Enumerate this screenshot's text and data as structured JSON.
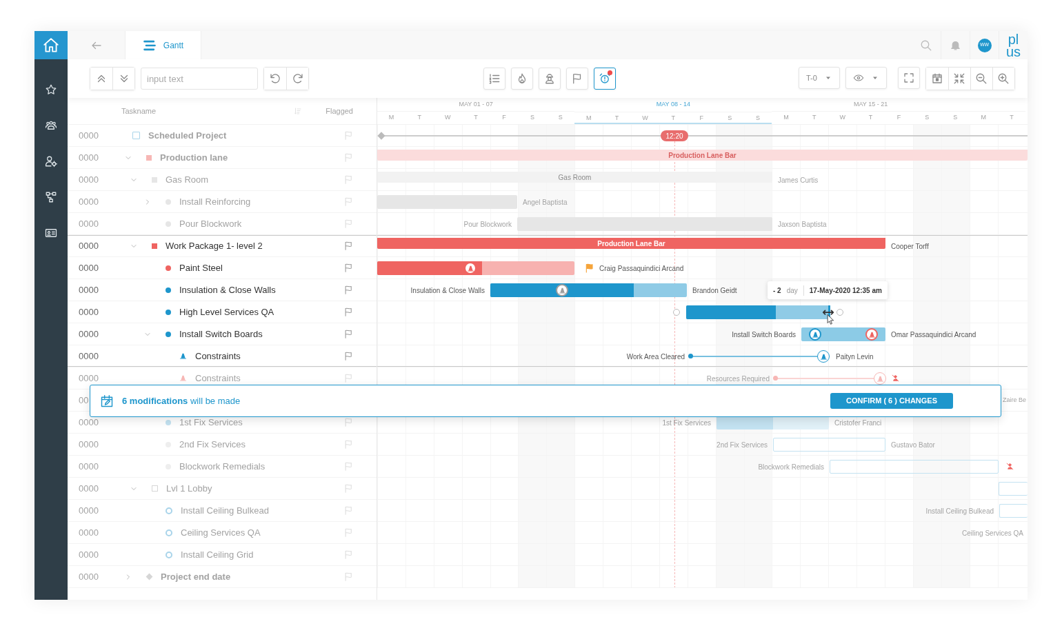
{
  "sidebar": {
    "items": [
      {
        "kind": "home",
        "selected": true
      },
      {
        "kind": "star",
        "selected": false
      },
      {
        "kind": "people",
        "selected": false
      },
      {
        "kind": "usergear",
        "selected": false
      },
      {
        "kind": "hierarchy",
        "selected": false
      },
      {
        "kind": "idcard",
        "selected": false
      }
    ]
  },
  "header": {
    "tabs": [
      {
        "label": "Gantt",
        "selected": true
      }
    ],
    "avatar": "WW",
    "logo_lines": [
      "pl",
      "us"
    ]
  },
  "toolbar": {
    "search": {
      "placeholder": "input text"
    },
    "view_tools": [
      {
        "kind": "list",
        "selected": false,
        "alert": false
      },
      {
        "kind": "flame",
        "selected": false,
        "alert": false
      },
      {
        "kind": "worker",
        "selected": false,
        "alert": false
      },
      {
        "kind": "flag",
        "selected": false,
        "alert": false
      },
      {
        "kind": "alarm",
        "selected": true,
        "alert": true
      }
    ],
    "dropdowns": [
      {
        "kind": "text",
        "label": "T-0"
      },
      {
        "kind": "eye"
      }
    ]
  },
  "task_table": {
    "columns": [
      "Taskname",
      "Flagged"
    ],
    "rows": [
      {
        "id": "0000",
        "name": "Scheduled Project",
        "kind": "checkbox",
        "color": "#a9d4ea",
        "dimmed": true,
        "children": [
          {
            "id": "0000",
            "name": "Production lane",
            "kind": "square",
            "color": "#f7b7b5",
            "expanded": true,
            "dimmed": true,
            "children": [
              {
                "id": "0000",
                "name": "Gas Room",
                "kind": "square",
                "color": "#e6e6e6",
                "expanded": true,
                "dimmed": true,
                "children": [
                  {
                    "id": "0000",
                    "name": "Install Reinforcing",
                    "kind": "dot",
                    "color": "#e6e6e6",
                    "expanded": false,
                    "dimmed": true
                  },
                  {
                    "id": "0000",
                    "name": "Pour Blockwork",
                    "kind": "dot",
                    "color": "#e6e6e6",
                    "dimmed": true
                  }
                ]
              },
              {
                "id": "0000",
                "name": "Work Package 1- level 2",
                "kind": "square",
                "color": "#ef6461",
                "expanded": true,
                "dimmed": false,
                "children": [
                  {
                    "id": "0000",
                    "name": "Paint Steel",
                    "kind": "dot",
                    "color": "#ef6461",
                    "dimmed": false
                  },
                  {
                    "id": "0000",
                    "name": "Insulation & Close Walls",
                    "kind": "dot",
                    "color": "#1e96cc",
                    "dimmed": false
                  },
                  {
                    "id": "0000",
                    "name": "High Level Services QA",
                    "kind": "dot",
                    "color": "#1e96cc",
                    "dimmed": false
                  },
                  {
                    "id": "0000",
                    "name": "Install Switch Boards",
                    "kind": "dot",
                    "color": "#1e96cc",
                    "expanded": true,
                    "dimmed": false,
                    "children": [
                      {
                        "id": "0000",
                        "name": "Constraints",
                        "kind": "cone",
                        "color": "#1e96cc",
                        "dimmed": false
                      },
                      {
                        "id": "0000",
                        "name": "Constraints",
                        "kind": "cone",
                        "color": "#f7b7b5",
                        "dimmed": true
                      }
                    ]
                  },
                  {
                    "id": "00",
                    "dimmed": true
                  },
                  {
                    "id": "0000",
                    "name": "1st Fix Services",
                    "kind": "dot",
                    "color": "#c3e2f1",
                    "dimmed": true
                  },
                  {
                    "id": "0000",
                    "name": "2nd Fix Services",
                    "kind": "dot",
                    "color": "#eeeeee",
                    "dimmed": true
                  },
                  {
                    "id": "0000",
                    "name": "Blockwork Remedials",
                    "kind": "dot",
                    "color": "#eeeeee",
                    "dimmed": true
                  }
                ]
              },
              {
                "id": "0000",
                "name": "Lvl 1 Lobby",
                "kind": "square-outline",
                "color": "#d6d6d6",
                "expanded": true,
                "dimmed": true,
                "children": [
                  {
                    "id": "0000",
                    "name": "Install Ceiling Bulkead",
                    "kind": "dot-outline",
                    "color": "#a9d4ea",
                    "dimmed": true
                  },
                  {
                    "id": "0000",
                    "name": "Ceiling Services QA",
                    "kind": "dot-outline",
                    "color": "#a9d4ea",
                    "dimmed": true
                  },
                  {
                    "id": "0000",
                    "name": "Install Ceiling Grid",
                    "kind": "dot-outline",
                    "color": "#a9d4ea",
                    "dimmed": true
                  }
                ]
              }
            ]
          },
          {
            "id": "0000",
            "name": "Project end date",
            "kind": "diamond",
            "color": "#d6d6d6",
            "expanded": false,
            "dimmed": true
          }
        ]
      }
    ]
  },
  "timeline": {
    "weeks": [
      {
        "label": "MAY 01 - 07",
        "selected": false,
        "days": [
          "M",
          "T",
          "W",
          "T",
          "F",
          "S",
          "S"
        ]
      },
      {
        "label": "MAY 08 - 14",
        "selected": true,
        "days": [
          "M",
          "T",
          "W",
          "T",
          "F",
          "S",
          "S"
        ]
      },
      {
        "label": "MAY 15 - 21",
        "selected": false,
        "days": [
          "M",
          "T",
          "W",
          "T",
          "F",
          "S",
          "S"
        ]
      },
      {
        "selected": false,
        "days": [
          "M",
          "T"
        ]
      }
    ],
    "lanes": [
      {
        "kind": "timeline",
        "marker": "12:20",
        "dimmed": true
      },
      {
        "kind": "summary",
        "label": "Production Lane Bar",
        "color": "#fbdcdc",
        "dimmed": true
      },
      {
        "kind": "summary",
        "label": "Gas Room",
        "label_right": "James Curtis",
        "color": "#f2f2f2",
        "dimmed": true
      },
      {
        "kind": "task",
        "label_right": "Angel Baptista",
        "color": "#e6e6e6",
        "level": 0,
        "dimmed": true
      },
      {
        "kind": "task",
        "label_left": "Pour Blockwork",
        "label_right": "Jaxson Baptista",
        "color": "#e6e6e6",
        "level": 0,
        "dimmed": true
      },
      {
        "kind": "summary",
        "label": "Production Lane Bar",
        "label_right": "Cooper Torff",
        "color": "#ef6461",
        "dimmed": false
      },
      {
        "kind": "task",
        "label_right": "Craig Passaquindici Arcand",
        "color": "#ef6461",
        "level": 0.53,
        "flagged": true,
        "resources": [
          {
            "color": "#ef6461"
          }
        ],
        "dimmed": false
      },
      {
        "kind": "task",
        "label_left": "Insulation & Close Walls",
        "label_right": "Brandon Geidt",
        "color": "#1e96cc",
        "level": 0.73,
        "resources": [
          {
            "color": "#9e9e9e"
          }
        ],
        "dimmed": false
      },
      {
        "kind": "task",
        "color": "#1e96cc",
        "level": 0.62,
        "dragging": true,
        "tooltip": {
          "offset": "- 2",
          "unit": "day",
          "date": "17-May-2020 12:35 am"
        },
        "dimmed": false
      },
      {
        "kind": "task",
        "label_left": "Install Switch Boards",
        "label_right": "Omar Passaquindici Arcand",
        "color": "#8ccbe6",
        "level": 0,
        "resources": [
          {
            "color": "#1e96cc"
          },
          {
            "color": "#ef6461"
          }
        ],
        "dimmed": false
      },
      {
        "kind": "link",
        "label_left": "Work Area Cleared",
        "label_right": "Paityn Levin",
        "color": "#1e96cc",
        "dimmed": false
      },
      {
        "kind": "link",
        "label_left": "Resources Required",
        "color": "#f7b7b5",
        "unassigned": true,
        "dimmed": true
      },
      {
        "kind": "text",
        "label_right": "Zaire Be",
        "dimmed": true
      },
      {
        "kind": "task",
        "label_left": "1st Fix Services",
        "label_right": "Cristofer Franci",
        "color": "#c3e2f1",
        "level": 0.5,
        "dimmed": true
      },
      {
        "kind": "planned",
        "label_left": "2nd Fix Services",
        "label_right": "Gustavo Bator",
        "color": "#c3e2f1",
        "dimmed": true
      },
      {
        "kind": "planned",
        "label_left": "Blockwork Remedials",
        "color": "#c3e2f1",
        "unassigned": true,
        "dimmed": true
      },
      {
        "kind": "planned",
        "color": "#c3e2f1",
        "dimmed": true
      },
      {
        "kind": "planned",
        "label_left": "Install Ceiling Bulkead",
        "color": "#c3e2f1",
        "dimmed": true
      },
      {
        "kind": "text",
        "label_left": "Ceiling Services QA",
        "dimmed": true
      },
      {
        "kind": "empty"
      },
      {
        "kind": "empty"
      }
    ]
  },
  "banner": {
    "message": "**6 modifications** will be made",
    "button": "CONFIRM ( 6 ) CHANGES"
  }
}
